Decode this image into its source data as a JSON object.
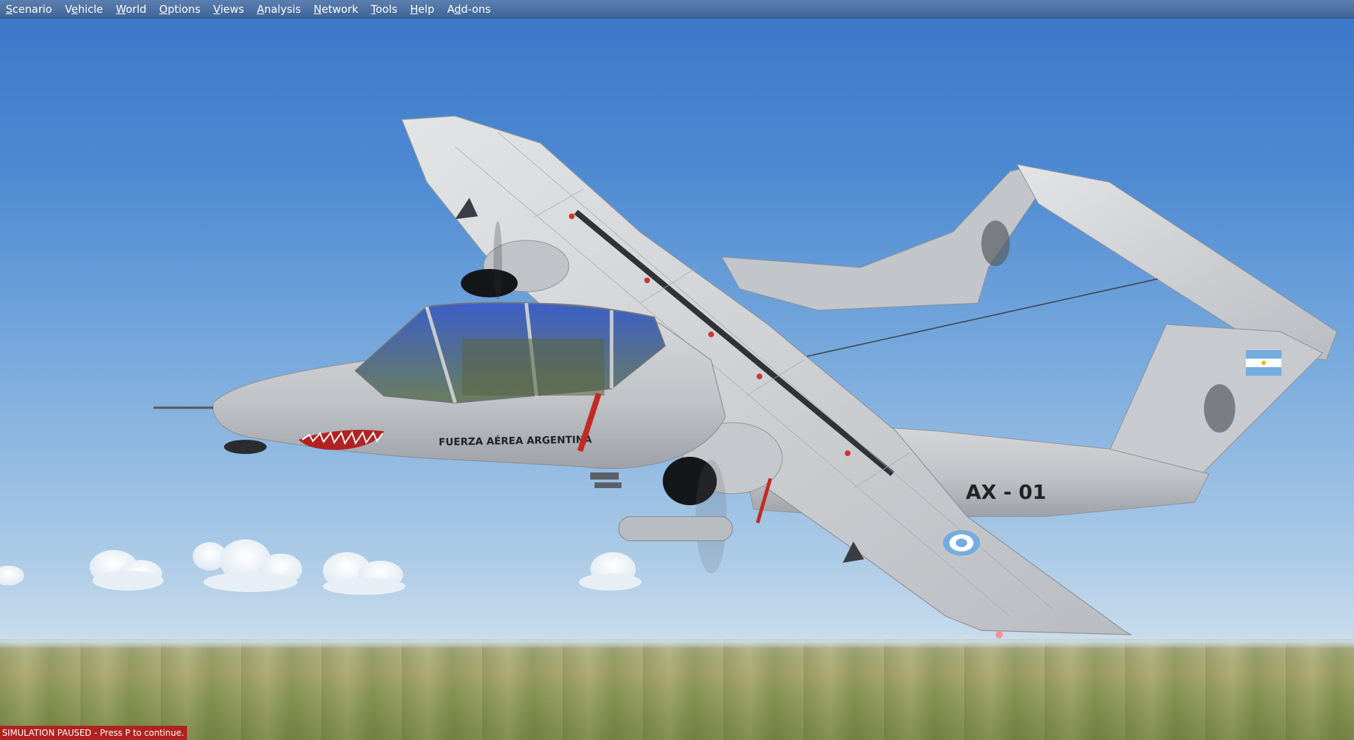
{
  "menubar": {
    "items": [
      {
        "pre": "",
        "acc": "S",
        "post": "cenario"
      },
      {
        "pre": "V",
        "acc": "e",
        "post": "hicle"
      },
      {
        "pre": "",
        "acc": "W",
        "post": "orld"
      },
      {
        "pre": "",
        "acc": "O",
        "post": "ptions"
      },
      {
        "pre": "",
        "acc": "V",
        "post": "iews"
      },
      {
        "pre": "",
        "acc": "A",
        "post": "nalysis"
      },
      {
        "pre": "",
        "acc": "N",
        "post": "etwork"
      },
      {
        "pre": "",
        "acc": "T",
        "post": "ools"
      },
      {
        "pre": "",
        "acc": "H",
        "post": "elp"
      },
      {
        "pre": "A",
        "acc": "d",
        "post": "d-ons"
      }
    ]
  },
  "aircraft": {
    "fuselage_text": "FUERZA AÉREA ARGENTINA",
    "tail_code": "AX - 01"
  },
  "status": {
    "message": "SIMULATION PAUSED - Press P to continue."
  },
  "colors": {
    "menubar": "#4a6fa1",
    "status_bg": "#b0231f",
    "sky_top": "#3d78c9",
    "aircraft_body": "#c9ccd0"
  }
}
